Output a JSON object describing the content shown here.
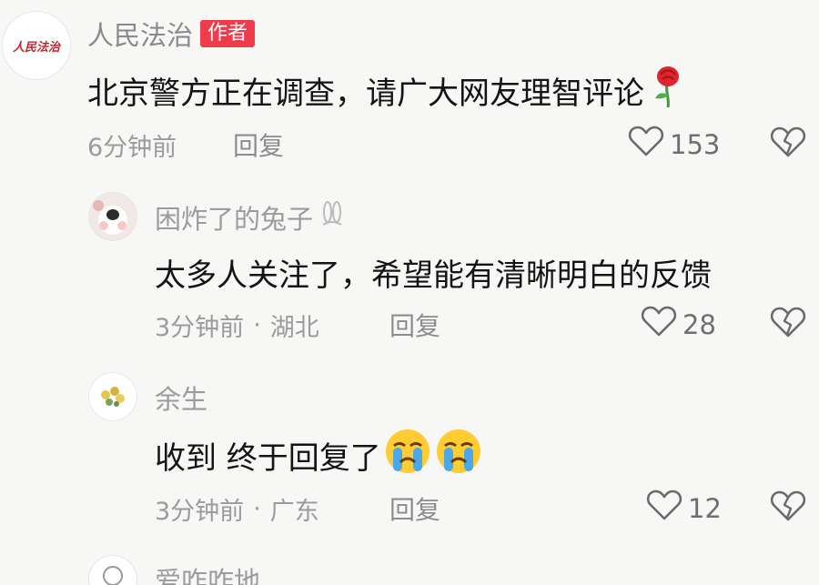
{
  "comments": [
    {
      "username": "人民法治",
      "badge": "作者",
      "avatar_text": "人民法治",
      "text": "北京警方正在调查，请广大网友理智评论",
      "emoji": "rose-emoji",
      "time": "6分钟前",
      "location": "",
      "reply_label": "回复",
      "likes": "153"
    },
    {
      "username": "困炸了的兔子",
      "text": "太多人关注了，希望能有清晰明白的反馈",
      "time": "3分钟前",
      "separator": "·",
      "location": "湖北",
      "reply_label": "回复",
      "likes": "28"
    },
    {
      "username": "余生",
      "text": "收到 终于回复了",
      "emoji": "crying-face-emoji",
      "time": "3分钟前",
      "separator": "·",
      "location": "广东",
      "reply_label": "回复",
      "likes": "12"
    },
    {
      "username": "爱咋咋地"
    }
  ],
  "colors": {
    "author_badge": "#ef3b4c",
    "username": "#8a8a8a",
    "meta": "#9b9b9b",
    "text": "#141414"
  }
}
